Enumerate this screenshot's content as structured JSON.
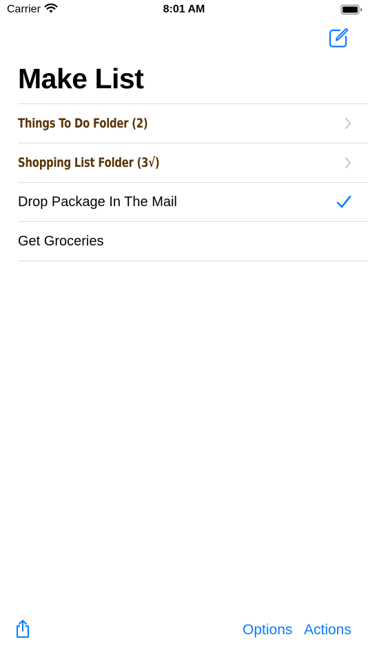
{
  "status": {
    "carrier": "Carrier",
    "time": "8:01 AM"
  },
  "nav": {
    "title": "Make List"
  },
  "list": {
    "items": [
      {
        "label": "Things To Do Folder (2)",
        "type": "folder"
      },
      {
        "label": "Shopping List Folder (3√)",
        "type": "folder"
      },
      {
        "label": "Drop Package In The Mail",
        "type": "item",
        "checked": true
      },
      {
        "label": "Get Groceries",
        "type": "item",
        "checked": false
      }
    ]
  },
  "toolbar": {
    "options_label": "Options",
    "actions_label": "Actions"
  },
  "colors": {
    "accent": "#0a7aff",
    "folder_text": "#5a3405",
    "separator": "#dcdcdc"
  }
}
